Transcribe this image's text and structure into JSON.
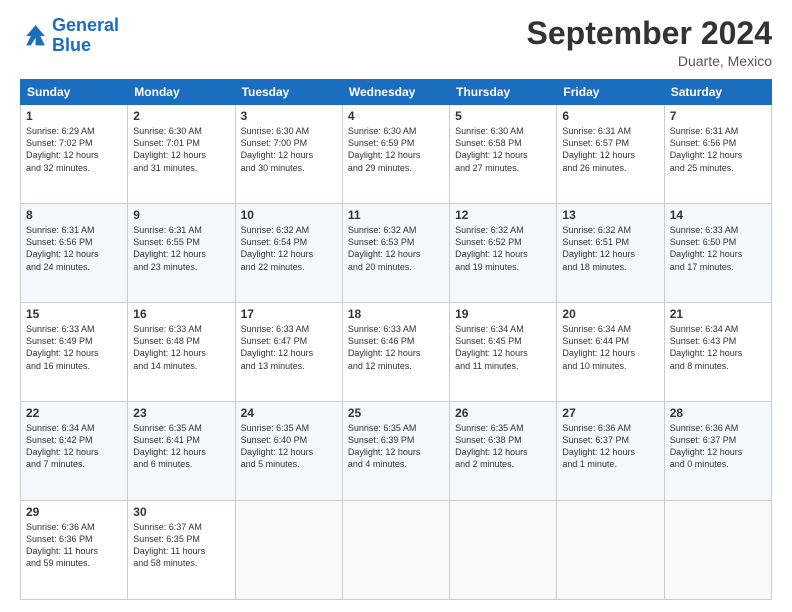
{
  "logo": {
    "line1": "General",
    "line2": "Blue"
  },
  "title": "September 2024",
  "location": "Duarte, Mexico",
  "days_header": [
    "Sunday",
    "Monday",
    "Tuesday",
    "Wednesday",
    "Thursday",
    "Friday",
    "Saturday"
  ],
  "weeks": [
    [
      {
        "day": "1",
        "lines": [
          "Sunrise: 6:29 AM",
          "Sunset: 7:02 PM",
          "Daylight: 12 hours",
          "and 32 minutes."
        ]
      },
      {
        "day": "2",
        "lines": [
          "Sunrise: 6:30 AM",
          "Sunset: 7:01 PM",
          "Daylight: 12 hours",
          "and 31 minutes."
        ]
      },
      {
        "day": "3",
        "lines": [
          "Sunrise: 6:30 AM",
          "Sunset: 7:00 PM",
          "Daylight: 12 hours",
          "and 30 minutes."
        ]
      },
      {
        "day": "4",
        "lines": [
          "Sunrise: 6:30 AM",
          "Sunset: 6:59 PM",
          "Daylight: 12 hours",
          "and 29 minutes."
        ]
      },
      {
        "day": "5",
        "lines": [
          "Sunrise: 6:30 AM",
          "Sunset: 6:58 PM",
          "Daylight: 12 hours",
          "and 27 minutes."
        ]
      },
      {
        "day": "6",
        "lines": [
          "Sunrise: 6:31 AM",
          "Sunset: 6:57 PM",
          "Daylight: 12 hours",
          "and 26 minutes."
        ]
      },
      {
        "day": "7",
        "lines": [
          "Sunrise: 6:31 AM",
          "Sunset: 6:56 PM",
          "Daylight: 12 hours",
          "and 25 minutes."
        ]
      }
    ],
    [
      {
        "day": "8",
        "lines": [
          "Sunrise: 6:31 AM",
          "Sunset: 6:56 PM",
          "Daylight: 12 hours",
          "and 24 minutes."
        ]
      },
      {
        "day": "9",
        "lines": [
          "Sunrise: 6:31 AM",
          "Sunset: 6:55 PM",
          "Daylight: 12 hours",
          "and 23 minutes."
        ]
      },
      {
        "day": "10",
        "lines": [
          "Sunrise: 6:32 AM",
          "Sunset: 6:54 PM",
          "Daylight: 12 hours",
          "and 22 minutes."
        ]
      },
      {
        "day": "11",
        "lines": [
          "Sunrise: 6:32 AM",
          "Sunset: 6:53 PM",
          "Daylight: 12 hours",
          "and 20 minutes."
        ]
      },
      {
        "day": "12",
        "lines": [
          "Sunrise: 6:32 AM",
          "Sunset: 6:52 PM",
          "Daylight: 12 hours",
          "and 19 minutes."
        ]
      },
      {
        "day": "13",
        "lines": [
          "Sunrise: 6:32 AM",
          "Sunset: 6:51 PM",
          "Daylight: 12 hours",
          "and 18 minutes."
        ]
      },
      {
        "day": "14",
        "lines": [
          "Sunrise: 6:33 AM",
          "Sunset: 6:50 PM",
          "Daylight: 12 hours",
          "and 17 minutes."
        ]
      }
    ],
    [
      {
        "day": "15",
        "lines": [
          "Sunrise: 6:33 AM",
          "Sunset: 6:49 PM",
          "Daylight: 12 hours",
          "and 16 minutes."
        ]
      },
      {
        "day": "16",
        "lines": [
          "Sunrise: 6:33 AM",
          "Sunset: 6:48 PM",
          "Daylight: 12 hours",
          "and 14 minutes."
        ]
      },
      {
        "day": "17",
        "lines": [
          "Sunrise: 6:33 AM",
          "Sunset: 6:47 PM",
          "Daylight: 12 hours",
          "and 13 minutes."
        ]
      },
      {
        "day": "18",
        "lines": [
          "Sunrise: 6:33 AM",
          "Sunset: 6:46 PM",
          "Daylight: 12 hours",
          "and 12 minutes."
        ]
      },
      {
        "day": "19",
        "lines": [
          "Sunrise: 6:34 AM",
          "Sunset: 6:45 PM",
          "Daylight: 12 hours",
          "and 11 minutes."
        ]
      },
      {
        "day": "20",
        "lines": [
          "Sunrise: 6:34 AM",
          "Sunset: 6:44 PM",
          "Daylight: 12 hours",
          "and 10 minutes."
        ]
      },
      {
        "day": "21",
        "lines": [
          "Sunrise: 6:34 AM",
          "Sunset: 6:43 PM",
          "Daylight: 12 hours",
          "and 8 minutes."
        ]
      }
    ],
    [
      {
        "day": "22",
        "lines": [
          "Sunrise: 6:34 AM",
          "Sunset: 6:42 PM",
          "Daylight: 12 hours",
          "and 7 minutes."
        ]
      },
      {
        "day": "23",
        "lines": [
          "Sunrise: 6:35 AM",
          "Sunset: 6:41 PM",
          "Daylight: 12 hours",
          "and 6 minutes."
        ]
      },
      {
        "day": "24",
        "lines": [
          "Sunrise: 6:35 AM",
          "Sunset: 6:40 PM",
          "Daylight: 12 hours",
          "and 5 minutes."
        ]
      },
      {
        "day": "25",
        "lines": [
          "Sunrise: 6:35 AM",
          "Sunset: 6:39 PM",
          "Daylight: 12 hours",
          "and 4 minutes."
        ]
      },
      {
        "day": "26",
        "lines": [
          "Sunrise: 6:35 AM",
          "Sunset: 6:38 PM",
          "Daylight: 12 hours",
          "and 2 minutes."
        ]
      },
      {
        "day": "27",
        "lines": [
          "Sunrise: 6:36 AM",
          "Sunset: 6:37 PM",
          "Daylight: 12 hours",
          "and 1 minute."
        ]
      },
      {
        "day": "28",
        "lines": [
          "Sunrise: 6:36 AM",
          "Sunset: 6:37 PM",
          "Daylight: 12 hours",
          "and 0 minutes."
        ]
      }
    ],
    [
      {
        "day": "29",
        "lines": [
          "Sunrise: 6:36 AM",
          "Sunset: 6:36 PM",
          "Daylight: 11 hours",
          "and 59 minutes."
        ]
      },
      {
        "day": "30",
        "lines": [
          "Sunrise: 6:37 AM",
          "Sunset: 6:35 PM",
          "Daylight: 11 hours",
          "and 58 minutes."
        ]
      },
      null,
      null,
      null,
      null,
      null
    ]
  ]
}
